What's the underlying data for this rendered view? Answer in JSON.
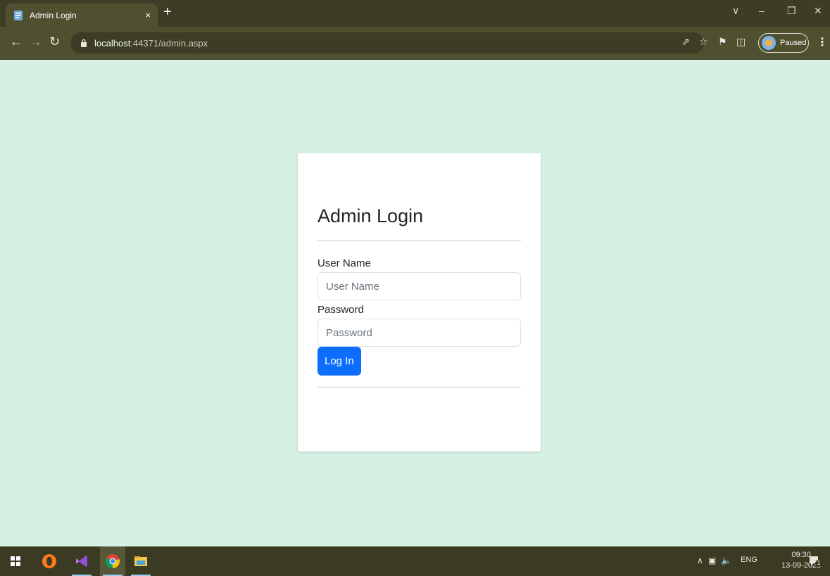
{
  "browser": {
    "tab_title": "Admin Login",
    "tab_close": "×",
    "new_tab": "+",
    "url_host": "localhost",
    "url_path": ":44371/admin.aspx",
    "profile_label": "Paused"
  },
  "page": {
    "heading": "Admin Login",
    "username_label": "User Name",
    "username_placeholder": "User Name",
    "password_label": "Password",
    "password_placeholder": "Password",
    "login_button": "Log In"
  },
  "taskbar": {
    "language": "ENG",
    "time": "09:30",
    "date": "13-09-2023",
    "notification_count": "1"
  },
  "colors": {
    "page_background": "#d6f0e3",
    "chrome": "#4f5030",
    "button_primary": "#0d6efd"
  }
}
